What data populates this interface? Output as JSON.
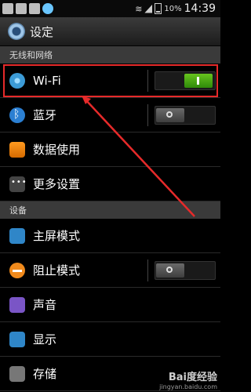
{
  "status_bar": {
    "battery": "10%",
    "time": "14:39",
    "icons": [
      "app-icon",
      "shield-icon",
      "image-icon",
      "update-icon",
      "wifi-icon",
      "signal-icon",
      "battery-icon"
    ]
  },
  "title_bar": {
    "title": "设定",
    "icon": "gear-icon"
  },
  "sections": [
    {
      "label": "无线和网络"
    },
    {
      "label": "设备"
    }
  ],
  "items": [
    {
      "label": "Wi-Fi",
      "icon": "wifi-icon",
      "toggle": "on"
    },
    {
      "label": "蓝牙",
      "icon": "bluetooth-icon",
      "toggle": "off"
    },
    {
      "label": "数据使用",
      "icon": "data-usage-icon"
    },
    {
      "label": "更多设置",
      "icon": "more-settings-icon"
    },
    {
      "label": "主屏模式",
      "icon": "home-screen-icon"
    },
    {
      "label": "阻止模式",
      "icon": "blocking-icon",
      "toggle": "off"
    },
    {
      "label": "声音",
      "icon": "sound-icon"
    },
    {
      "label": "显示",
      "icon": "display-icon"
    },
    {
      "label": "存储",
      "icon": "storage-icon"
    }
  ],
  "annotation": {
    "color": "#e62a2a"
  },
  "watermark": {
    "main": "Bai度经验",
    "sub": "jingyan.baidu.com"
  }
}
